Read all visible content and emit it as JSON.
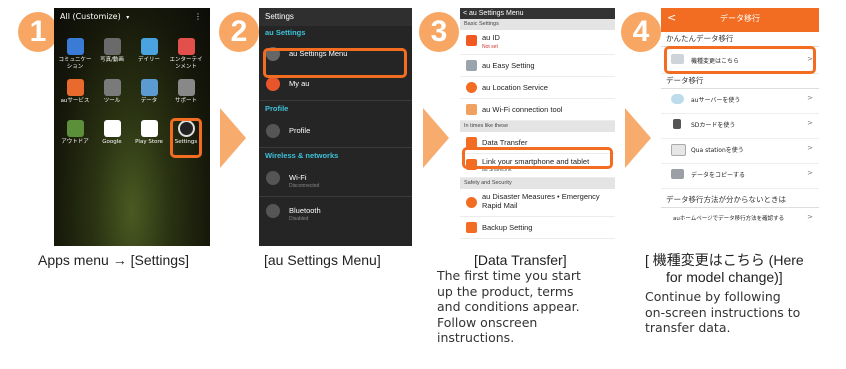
{
  "steps": [
    "1",
    "2",
    "3",
    "4"
  ],
  "phone1": {
    "header": "All (Customize)",
    "menu": "⋮",
    "apps": [
      {
        "label": "コミュニケー\nション",
        "color": "#3a7bd5"
      },
      {
        "label": "写真/動画",
        "color": "#6a6a6a"
      },
      {
        "label": "デイリー",
        "color": "#4aa3df"
      },
      {
        "label": "エンターテイ\nンメント",
        "color": "#e2504c"
      },
      {
        "label": "auサービス",
        "color": "#e86a2c"
      },
      {
        "label": "ツール",
        "color": "#7a7a7a"
      },
      {
        "label": "データ",
        "color": "#5c9bd1"
      },
      {
        "label": "サポート",
        "color": "#888888"
      },
      {
        "label": "アウトドア",
        "color": "#5b8f3a"
      },
      {
        "label": "Google",
        "color": "#ffffff"
      },
      {
        "label": "Play Store",
        "color": "#ffffff"
      },
      {
        "label": "Settings",
        "color": "#222222"
      }
    ]
  },
  "phone2": {
    "title": "Settings",
    "sect_au": "au Settings",
    "row_menu": "au Settings Menu",
    "row_myau": "My au",
    "sect_profile": "Profile",
    "row_profile": "Profile",
    "sect_wireless": "Wireless & networks",
    "row_wifi": "Wi-Fi",
    "row_wifi_sub": "Disconnected",
    "row_bt": "Bluetooth",
    "row_bt_sub": "Disabled"
  },
  "phone3": {
    "title": "< au Settings Menu",
    "sect_basic": "Basic Settings",
    "row_auid": "au ID",
    "row_auid_sub": "Not set",
    "row_easy": "au Easy Setting",
    "row_location": "au Location Service",
    "row_wifi": "au Wi-Fi connection tool",
    "sect_times": "In times like these",
    "row_transfer": "Data Transfer",
    "row_link": "Link your smartphone and tablet",
    "row_link_sub": "au ShareLink",
    "sect_safety": "Safety and Security",
    "row_disaster": "au Disaster Measures • Emergency Rapid Mail",
    "row_backup": "Backup Setting"
  },
  "phone4": {
    "back": "<",
    "title": "データ移行",
    "sect_easy": "かんたんデータ移行",
    "row_change": "機種変更はこちら",
    "sect_transfer": "データ移行",
    "row_server": "auサーバーを使う",
    "row_sd": "SDカードを使う",
    "row_qua": "Qua stationを使う",
    "row_copy": "データをコピーする",
    "sect_help": "データ移行方法が分からないときは",
    "row_help": "auホームページでデータ移行方法を確認する",
    "chevron": ">"
  },
  "captions": {
    "c1": "Apps menu → [Settings]",
    "c2": "[au Settings Menu]",
    "c3_title": "[Data Transfer]",
    "c3_desc": "The first time you start\nup the product, terms\nand conditions appear.\nFollow onscreen\ninstructions.",
    "c4_title": "[ 機種変更はこちら (Here\nfor model change)]",
    "c4_desc": "Continue by following\non-screen instructions to\ntransfer data."
  }
}
